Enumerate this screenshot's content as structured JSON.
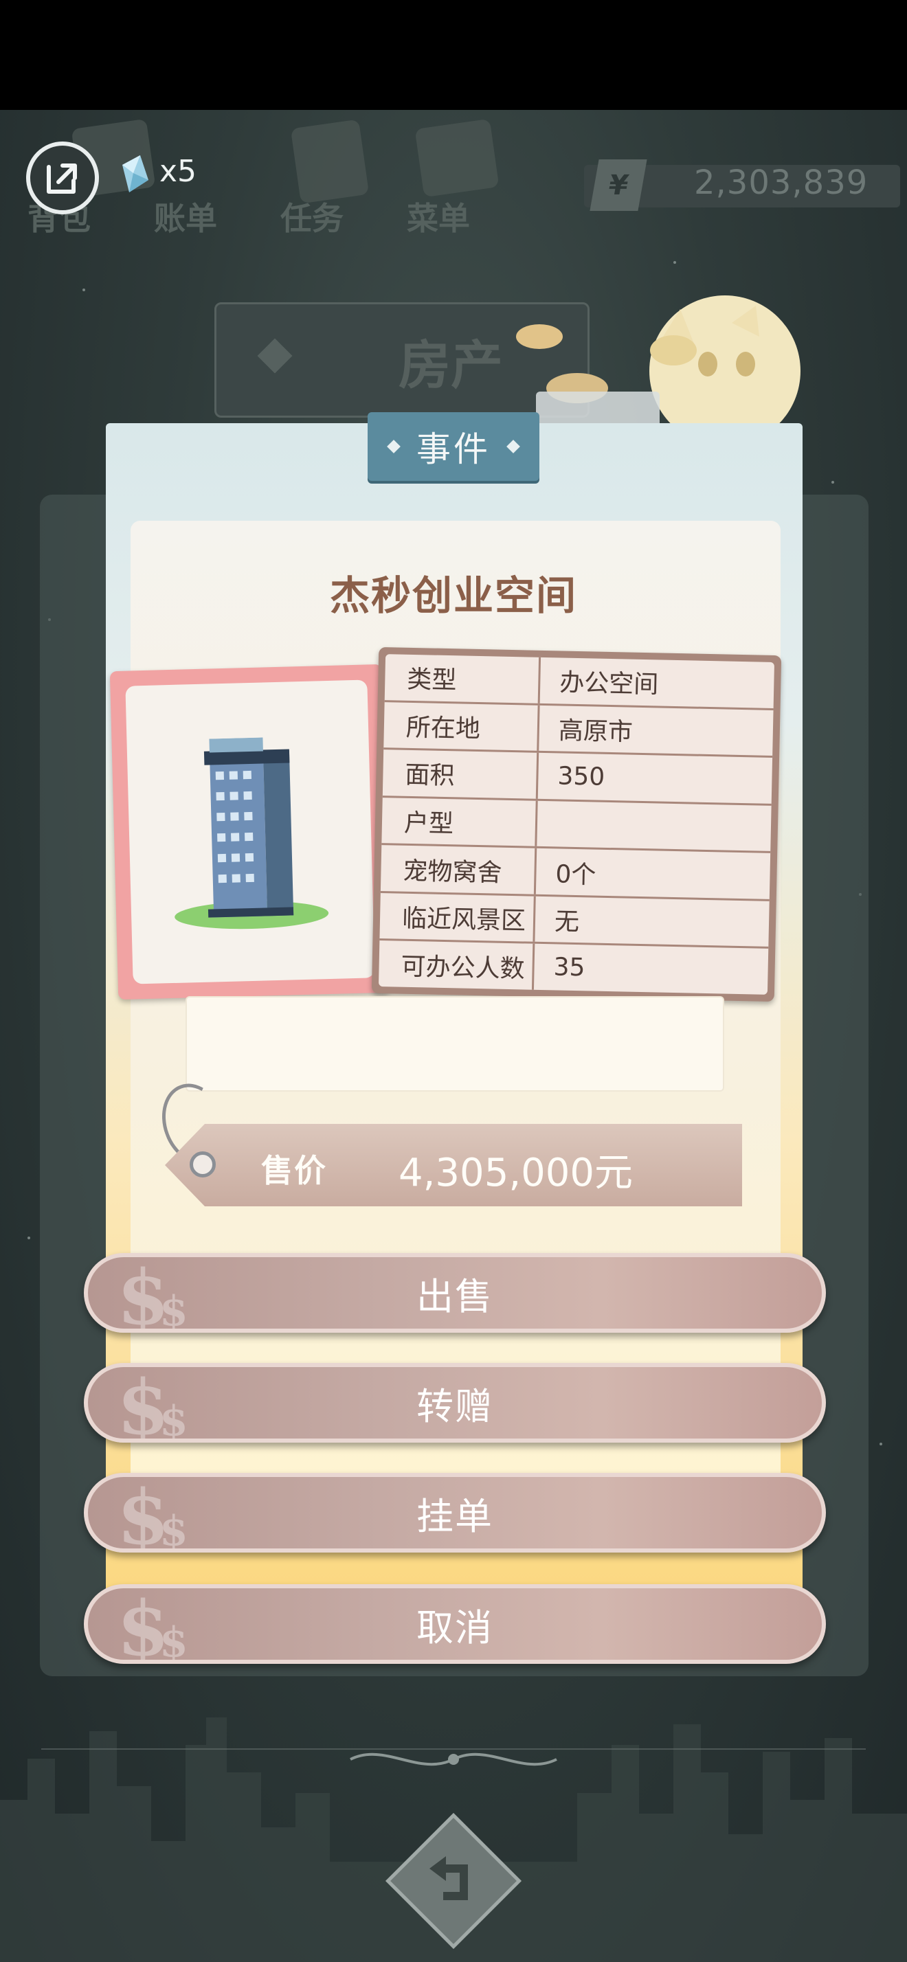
{
  "topbar": {
    "items": [
      "背包",
      "账单",
      "任务",
      "菜单"
    ],
    "gem_count": "x5",
    "currency_symbol": "¥",
    "balance": "2,303,839"
  },
  "background": {
    "banner": "房产"
  },
  "dialog": {
    "header": "事件",
    "title": "杰秒创业空间",
    "info": [
      {
        "key": "类型",
        "value": "办公空间"
      },
      {
        "key": "所在地",
        "value": "高原市"
      },
      {
        "key": "面积",
        "value": "350"
      },
      {
        "key": "户型",
        "value": ""
      },
      {
        "key": "宠物窝舍",
        "value": "0个"
      },
      {
        "key": "临近风景区",
        "value": "无"
      },
      {
        "key": "可办公人数",
        "value": "35"
      }
    ],
    "price_label": "售价",
    "price_value": "4,305,000元",
    "buttons": {
      "sell": "出售",
      "gift": "转赠",
      "list": "挂单",
      "cancel": "取消"
    },
    "button_symbol_large": "$",
    "button_symbol_small": "$"
  }
}
